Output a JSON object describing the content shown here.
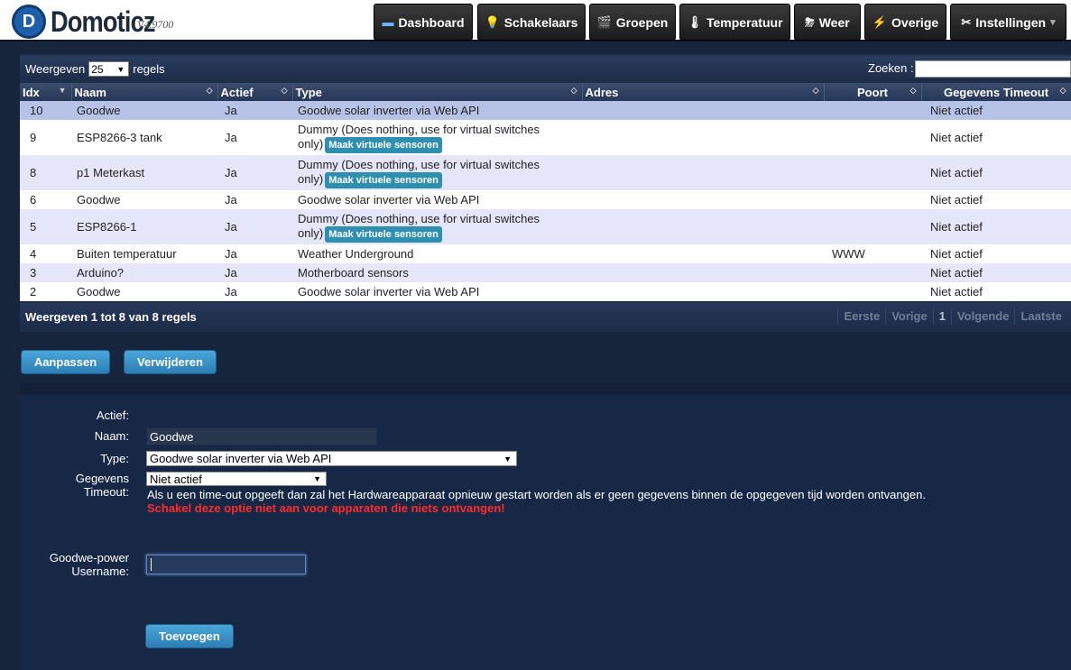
{
  "app": {
    "logo_letter": "D",
    "name": "Domoticz",
    "version": "V4.9700"
  },
  "nav": [
    {
      "label": "Dashboard",
      "icon": "dashboard-icon",
      "glyph": "▬"
    },
    {
      "label": "Schakelaars",
      "icon": "lightbulb-icon",
      "glyph": "💡"
    },
    {
      "label": "Groepen",
      "icon": "scenes-icon",
      "glyph": "🎬"
    },
    {
      "label": "Temperatuur",
      "icon": "thermometer-icon",
      "glyph": "🌡"
    },
    {
      "label": "Weer",
      "icon": "weather-icon",
      "glyph": "⛈"
    },
    {
      "label": "Overige",
      "icon": "utility-icon",
      "glyph": "⚡"
    },
    {
      "label": "Instellingen",
      "icon": "settings-icon",
      "glyph": "✂",
      "caret": "▾"
    }
  ],
  "table": {
    "show_prefix": "Weergeven",
    "page_length": "25",
    "show_suffix": "regels",
    "search_label": "Zoeken :",
    "search_value": "",
    "columns": [
      "Idx",
      "Naam",
      "Actief",
      "Type",
      "Adres",
      "Poort",
      "Gegevens Timeout"
    ],
    "rows": [
      {
        "idx": "10",
        "name": "Goodwe",
        "enabled": "Ja",
        "type": "Goodwe solar inverter via Web API",
        "type2": "",
        "button": "",
        "address": "",
        "port": "",
        "timeout": "Niet actief",
        "style": "row-sel"
      },
      {
        "idx": "9",
        "name": "ESP8266-3 tank",
        "enabled": "Ja",
        "type": "Dummy (Does nothing, use for virtual switches",
        "type2": "only)",
        "button": "Maak virtuele sensoren",
        "address": "",
        "port": "",
        "timeout": "Niet actief",
        "style": "row-even"
      },
      {
        "idx": "8",
        "name": "p1 Meterkast",
        "enabled": "Ja",
        "type": "Dummy (Does nothing, use for virtual switches",
        "type2": "only)",
        "button": "Maak virtuele sensoren",
        "address": "",
        "port": "",
        "timeout": "Niet actief",
        "style": "row-odd"
      },
      {
        "idx": "6",
        "name": "Goodwe",
        "enabled": "Ja",
        "type": "Goodwe solar inverter via Web API",
        "type2": "",
        "button": "",
        "address": "",
        "port": "",
        "timeout": "Niet actief",
        "style": "row-even"
      },
      {
        "idx": "5",
        "name": "ESP8266-1",
        "enabled": "Ja",
        "type": "Dummy (Does nothing, use for virtual switches",
        "type2": "only)",
        "button": "Maak virtuele sensoren",
        "address": "",
        "port": "",
        "timeout": "Niet actief",
        "style": "row-odd"
      },
      {
        "idx": "4",
        "name": "Buiten temperatuur",
        "enabled": "Ja",
        "type": "Weather Underground",
        "type2": "",
        "button": "",
        "address": "",
        "port": "WWW",
        "timeout": "Niet actief",
        "style": "row-even"
      },
      {
        "idx": "3",
        "name": "Arduino?",
        "enabled": "Ja",
        "type": "Motherboard sensors",
        "type2": "",
        "button": "",
        "address": "",
        "port": "",
        "timeout": "Niet actief",
        "style": "row-odd"
      },
      {
        "idx": "2",
        "name": "Goodwe",
        "enabled": "Ja",
        "type": "Goodwe solar inverter via Web API",
        "type2": "",
        "button": "",
        "address": "",
        "port": "",
        "timeout": "Niet actief",
        "style": "row-even"
      }
    ],
    "info": "Weergeven 1 tot 8 van 8 regels",
    "paging": [
      "Eerste",
      "Vorige",
      "1",
      "Volgende",
      "Laatste"
    ]
  },
  "actions": {
    "update_label": "Aanpassen",
    "delete_label": "Verwijderen"
  },
  "form": {
    "enabled_label": "Actief:",
    "name_label": "Naam:",
    "name_value": "Goodwe",
    "type_label": "Type:",
    "type_value": "Goodwe solar inverter via Web API",
    "timeout_label_1": "Gegevens",
    "timeout_label_2": "Timeout:",
    "timeout_value": "Niet actief",
    "help": "Als u een time-out opgeeft dan zal het Hardwareapparaat opnieuw gestart worden als er geen gegevens binnen de opgegeven tijd worden ontvangen.",
    "warning": "Schakel deze optie niet aan voor apparaten die niets ontvangen!",
    "user_label_1": "Goodwe-power",
    "user_label_2": "Username:",
    "user_value": "",
    "add_label": "Toevoegen"
  },
  "colors": {
    "accent": "#2c7fb6",
    "warning": "#ff2a2a",
    "background": "#16243c"
  }
}
